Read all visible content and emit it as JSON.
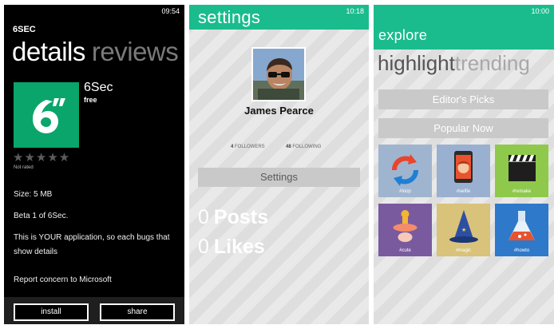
{
  "details": {
    "clock": "09:54",
    "app_caption": "6SEC",
    "pivot": {
      "active": "details",
      "inactive": "reviews"
    },
    "app_name": "6Sec",
    "price": "free",
    "rating_stars": "★★★★★",
    "rating_label": "Not rated",
    "size": "Size: 5 MB",
    "version": "Beta 1 of 6Sec.",
    "description": "This is YOUR application, so each bugs that show details",
    "report": "Report concern to Microsoft",
    "install_label": "install",
    "share_label": "share",
    "tile_color": "#0aa56b"
  },
  "profile": {
    "title": "settings",
    "clock": "10:18",
    "user_name": "James Pearce",
    "followers_count": "4",
    "followers_label": "FOLLOWERS",
    "following_count": "48",
    "following_label": "FOLLOWING",
    "settings_button": "Settings",
    "posts_count": "0",
    "posts_label": "Posts",
    "likes_count": "0",
    "likes_label": "Likes",
    "accent": "#1abc8d"
  },
  "explore": {
    "title": "explore",
    "clock": "10:00",
    "pivot": {
      "active": "highlight",
      "inactive": "trending"
    },
    "editors_picks": "Editor's Picks",
    "popular_now": "Popular Now",
    "categories": [
      {
        "label": "#loop",
        "color": "#9fb5cf",
        "icon": "loop-icon"
      },
      {
        "label": "#selfie",
        "color": "#9ab0d1",
        "icon": "phone-face-icon"
      },
      {
        "label": "#remake",
        "color": "#8fc94b",
        "icon": "clapperboard-icon"
      },
      {
        "label": "#cute",
        "color": "#7a5a9e",
        "icon": "pacifier-icon"
      },
      {
        "label": "#magic",
        "color": "#d9c27a",
        "icon": "wizard-hat-icon"
      },
      {
        "label": "#howto",
        "color": "#2e79c9",
        "icon": "flask-icon"
      }
    ]
  }
}
